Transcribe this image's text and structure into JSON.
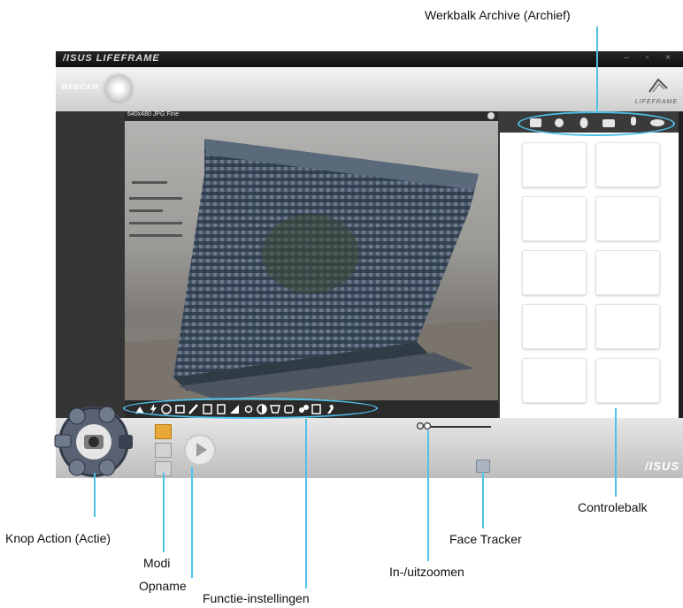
{
  "callouts": {
    "archive_toolbar": "Werkbalk Archive (Archief)",
    "action_button": "Knop Action (Actie)",
    "modes": "Modi",
    "record": "Opname",
    "function_settings": "Functie-instellingen",
    "face_tracker": "Face Tracker",
    "zoom": "In-/uitzoomen",
    "control_bar": "Controlebalk"
  },
  "app": {
    "brand": "/ISUS LIFEFRAME",
    "window_controls": "– ▫ ×",
    "header_mode": "WEBCAM",
    "logo_text": "LIFEFRAME",
    "resolution": "640x480 JPG Fine",
    "bottom_logo": "/ISUS"
  },
  "icons": {
    "archive_toolbar": [
      "camera-icon",
      "gear-icon",
      "face-icon",
      "video-icon",
      "microphone-icon",
      "eye-icon"
    ],
    "modes": [
      "camera-mode-icon",
      "settings-mode-icon",
      "face-mode-icon"
    ],
    "functions": [
      "scene-icon",
      "flash-icon",
      "timer-icon",
      "burst-icon",
      "ruler-icon",
      "frame-icon",
      "effect-icon",
      "tone-icon",
      "brightness-icon",
      "contrast-icon",
      "white-balance-icon",
      "mask-icon",
      "color-icon",
      "photo-icon",
      "tools-icon"
    ]
  },
  "colors": {
    "callout": "#4fc1e9",
    "window_dark": "#3a3a3a"
  }
}
